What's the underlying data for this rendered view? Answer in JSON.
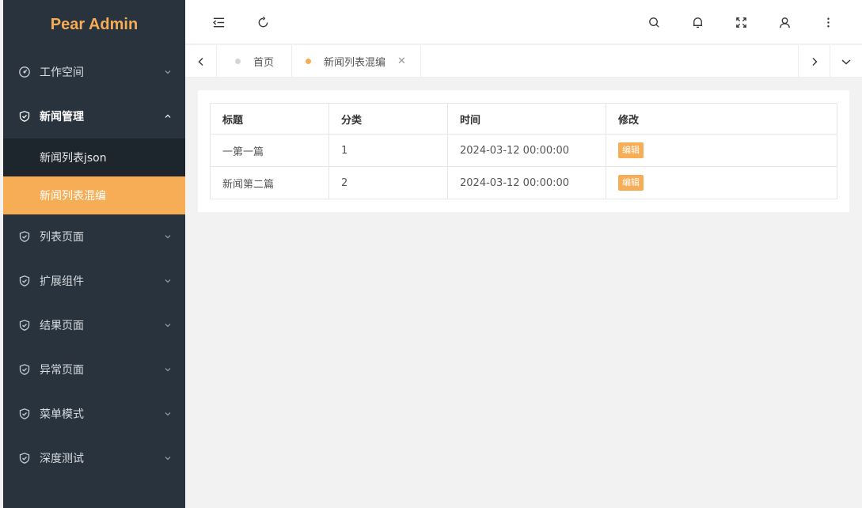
{
  "app": {
    "title": "Pear Admin"
  },
  "sidebar": {
    "items": [
      {
        "label": "工作空间",
        "icon": "dashboard-icon"
      },
      {
        "label": "新闻管理",
        "icon": "shield-icon",
        "open": true,
        "children": [
          {
            "label": "新闻列表json"
          },
          {
            "label": "新闻列表混编",
            "active": true
          }
        ]
      },
      {
        "label": "列表页面",
        "icon": "shield-icon"
      },
      {
        "label": "扩展组件",
        "icon": "shield-icon"
      },
      {
        "label": "结果页面",
        "icon": "shield-icon"
      },
      {
        "label": "异常页面",
        "icon": "shield-icon"
      },
      {
        "label": "菜单模式",
        "icon": "shield-icon"
      },
      {
        "label": "深度测试",
        "icon": "shield-icon"
      }
    ]
  },
  "header": {
    "icons": [
      "menu-collapse-icon",
      "refresh-icon",
      "search-icon",
      "bell-icon",
      "fullscreen-icon",
      "user-icon",
      "more-vertical-icon"
    ]
  },
  "tabs": [
    {
      "label": "首页",
      "active": false
    },
    {
      "label": "新闻列表混编",
      "active": true,
      "closable": true
    }
  ],
  "table": {
    "columns": [
      "标题",
      "分类",
      "时间",
      "修改"
    ],
    "rows": [
      {
        "title": "一第一篇",
        "category": "1",
        "time": "2024-03-12 00:00:00",
        "action": "编辑"
      },
      {
        "title": "新闻第二篇",
        "category": "2",
        "time": "2024-03-12 00:00:00",
        "action": "编辑"
      }
    ]
  },
  "colors": {
    "accent": "#f6ad55",
    "sidebar_bg": "#28333e",
    "submenu_bg": "#1d252d",
    "page_bg": "#f2f2f2"
  }
}
